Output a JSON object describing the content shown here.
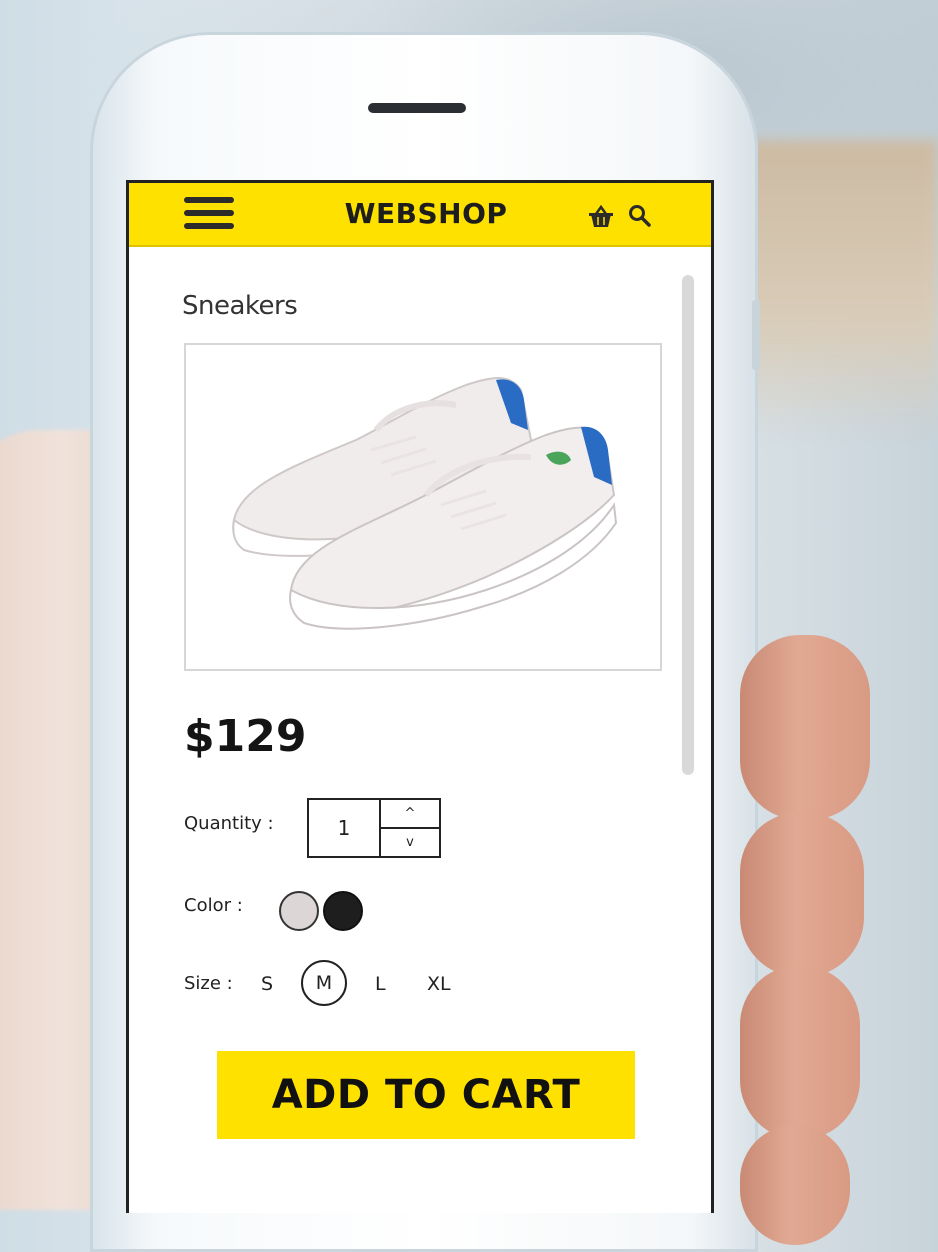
{
  "header": {
    "brand": "WEBSHOP",
    "menu_icon": "hamburger-menu-icon",
    "cart_icon": "basket-icon",
    "search_icon": "search-icon"
  },
  "product": {
    "title": "Sneakers",
    "image": "white-sneakers-image",
    "price": "$129"
  },
  "quantity": {
    "label": "Quantity :",
    "value": "1",
    "up": "^",
    "down": "v"
  },
  "color": {
    "label": "Color :",
    "options": [
      "#dcd6d6",
      "#1e1e1e"
    ]
  },
  "size": {
    "label": "Size :",
    "options": [
      "S",
      "M",
      "L",
      "XL"
    ],
    "selected": "M"
  },
  "cta": {
    "add_to_cart": "ADD TO CART"
  },
  "colors": {
    "accent": "#ffe100",
    "text": "#141414"
  }
}
